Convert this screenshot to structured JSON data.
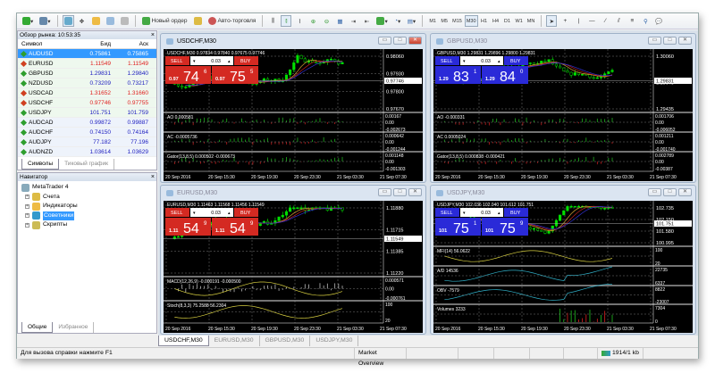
{
  "toolbar": {
    "new_order": "Новый ордер",
    "auto_trading": "Авто-торговля",
    "timeframes": [
      "M1",
      "M5",
      "M15",
      "M30",
      "H1",
      "H4",
      "D1",
      "W1",
      "MN"
    ],
    "active_timeframe": "M30"
  },
  "market_watch": {
    "title": "Обзор рынка: 10:53:35",
    "columns": [
      "Символ",
      "Бид",
      "Аск"
    ],
    "rows": [
      {
        "symbol": "AUDUSD",
        "bid": "0.75861",
        "ask": "0.75865",
        "dir": "up",
        "selected": true
      },
      {
        "symbol": "EURUSD",
        "bid": "1.11549",
        "ask": "1.11549",
        "dir": "down"
      },
      {
        "symbol": "GBPUSD",
        "bid": "1.29831",
        "ask": "1.29840",
        "dir": "up"
      },
      {
        "symbol": "NZDUSD",
        "bid": "0.73209",
        "ask": "0.73217",
        "dir": "up"
      },
      {
        "symbol": "USDCAD",
        "bid": "1.31652",
        "ask": "1.31660",
        "dir": "down"
      },
      {
        "symbol": "USDCHF",
        "bid": "0.97746",
        "ask": "0.97755",
        "dir": "down"
      },
      {
        "symbol": "USDJPY",
        "bid": "101.751",
        "ask": "101.759",
        "dir": "up"
      },
      {
        "symbol": "AUDCAD",
        "bid": "0.99872",
        "ask": "0.99887",
        "dir": "up"
      },
      {
        "symbol": "AUDCHF",
        "bid": "0.74150",
        "ask": "0.74164",
        "dir": "up"
      },
      {
        "symbol": "AUDJPY",
        "bid": "77.182",
        "ask": "77.196",
        "dir": "up"
      },
      {
        "symbol": "AUDNZD",
        "bid": "1.03614",
        "ask": "1.03629",
        "dir": "up"
      }
    ],
    "tabs": [
      "Символы",
      "Тиковый график"
    ]
  },
  "navigator": {
    "title": "Навигатор",
    "root": "MetaTrader 4",
    "items": [
      "Счета",
      "Индикаторы",
      "Советники",
      "Скрипты"
    ],
    "selected": "Советники",
    "tabs": [
      "Общие",
      "Избранное"
    ]
  },
  "colors": {
    "sell_red": "#d42a22",
    "buy_blue": "#2a2ad8",
    "candle": "#00e000",
    "up": "#2e9e2e",
    "down": "#d04020",
    "bid_up": "#2020c0",
    "bid_down": "#e02020"
  },
  "charts": [
    {
      "title": "USDCHF,M30",
      "header": "USDCHF,M30  0.97834 0.97840 0.97675 0.97746",
      "panel": "red",
      "active": true,
      "sell": "SELL",
      "buy": "BUY",
      "lots": "0.03",
      "sell_pre": "0.97",
      "sell_big": "74",
      "sell_sup": "6",
      "buy_pre": "0.97",
      "buy_big": "75",
      "buy_sup": "5",
      "prices": [
        "0.98060",
        "0.97930",
        "0.97800",
        "0.97670"
      ],
      "current": "0.97746",
      "panes": [
        {
          "label": "AO 0.000581",
          "type": "hist",
          "scale": [
            "0.00167",
            "0.00",
            "-0.002673"
          ]
        },
        {
          "label": "AC -0.0005736",
          "type": "hist",
          "scale": [
            "0.000642",
            "0.00",
            "-0.001244"
          ]
        },
        {
          "label": "Gator(13,8,5) 0.000502 -0.000673",
          "type": "hist",
          "scale": [
            "0.001148",
            "0.00",
            "-0.001303"
          ]
        }
      ],
      "times": [
        "20 Sep 2016",
        "20 Sep 15:30",
        "20 Sep 19:30",
        "20 Sep 23:30",
        "21 Sep 03:30",
        "21 Sep 07:30"
      ]
    },
    {
      "title": "GBPUSD,M30",
      "header": "GBPUSD,M30  1.29831 1.29896 1.29800 1.29831",
      "panel": "blue",
      "sell": "SELL",
      "buy": "BUY",
      "lots": "0.03",
      "sell_pre": "1.29",
      "sell_big": "83",
      "sell_sup": "1",
      "buy_pre": "1.29",
      "buy_big": "84",
      "buy_sup": "0",
      "prices": [
        "1.30060",
        "1.29645",
        "1.29435"
      ],
      "current": "1.29831",
      "panes": [
        {
          "label": "AO -0.000331",
          "type": "hist",
          "scale": [
            "0.001706",
            "0.00",
            "-0.006052"
          ]
        },
        {
          "label": "AC 0.0005024",
          "type": "hist",
          "scale": [
            "0.001211",
            "0.00",
            "-0.001740"
          ]
        },
        {
          "label": "Gator(13,8,5) 0.000838 -0.000421",
          "type": "hist",
          "scale": [
            "0.002789",
            "0.00",
            "-0.00387"
          ]
        }
      ],
      "times": [
        "20 Sep 2016",
        "20 Sep 15:30",
        "20 Sep 19:30",
        "20 Sep 23:30",
        "21 Sep 03:30",
        "21 Sep 07:30"
      ]
    },
    {
      "title": "EURUSD,M30",
      "header": "EURUSD,M30  1.11463 1.11568 1.11456 1.11549",
      "panel": "red",
      "sell": "SELL",
      "buy": "BUY",
      "lots": "0.03",
      "sell_pre": "1.11",
      "sell_big": "54",
      "sell_sup": "9",
      "buy_pre": "1.11",
      "buy_big": "54",
      "buy_sup": "9",
      "prices": [
        "1.11880",
        "1.11715",
        "1.11385",
        "1.11220"
      ],
      "current": "1.11549",
      "panes": [
        {
          "label": "MACD(12,26,9) -0.000191 -0.000500",
          "type": "macd",
          "scale": [
            "0.000571",
            "0.00",
            "-0.000761"
          ]
        },
        {
          "label": "Stoch(8,3,3) 75.2588 56.2304",
          "type": "line",
          "scale": [
            "100",
            "20"
          ]
        }
      ],
      "times": [
        "20 Sep 2016",
        "20 Sep 15:30",
        "20 Sep 19:30",
        "20 Sep 23:30",
        "21 Sep 03:30",
        "21 Sep 07:30"
      ]
    },
    {
      "title": "USDJPY,M30",
      "header": "USDJPY,M30  102.036 102.040 101.612 101.751",
      "panel": "blue",
      "sell": "SELL",
      "buy": "BUY",
      "lots": "0.03",
      "sell_pre": "101",
      "sell_big": "75",
      "sell_sup": "1",
      "buy_pre": "101",
      "buy_big": "75",
      "buy_sup": "9",
      "prices": [
        "102.735",
        "102.150",
        "101.580",
        "100.995"
      ],
      "current": "101.751",
      "panes": [
        {
          "label": "MFI(14) 56.0622",
          "type": "line",
          "scale": [
            "100",
            "20"
          ]
        },
        {
          "label": "A/D 14536",
          "type": "cyan",
          "scale": [
            "22735",
            "6337"
          ]
        },
        {
          "label": "OBV -7579",
          "type": "cyan",
          "scale": [
            "8822",
            "-23007"
          ]
        },
        {
          "label": "Volumes 3233",
          "type": "vol",
          "scale": [
            "7304",
            "0"
          ]
        }
      ],
      "times": [
        "20 Sep 2016",
        "20 Sep 15:30",
        "20 Sep 19:30",
        "20 Sep 23:30",
        "21 Sep 03:30",
        "21 Sep 07:30"
      ]
    }
  ],
  "chart_tabs": [
    "USDCHF,M30",
    "EURUSD,M30",
    "GBPUSD,M30",
    "USDJPY,M30"
  ],
  "status": {
    "help": "Для вызова справки нажмите F1",
    "profile": "Market Overview",
    "traffic": "1914/1 kb"
  }
}
